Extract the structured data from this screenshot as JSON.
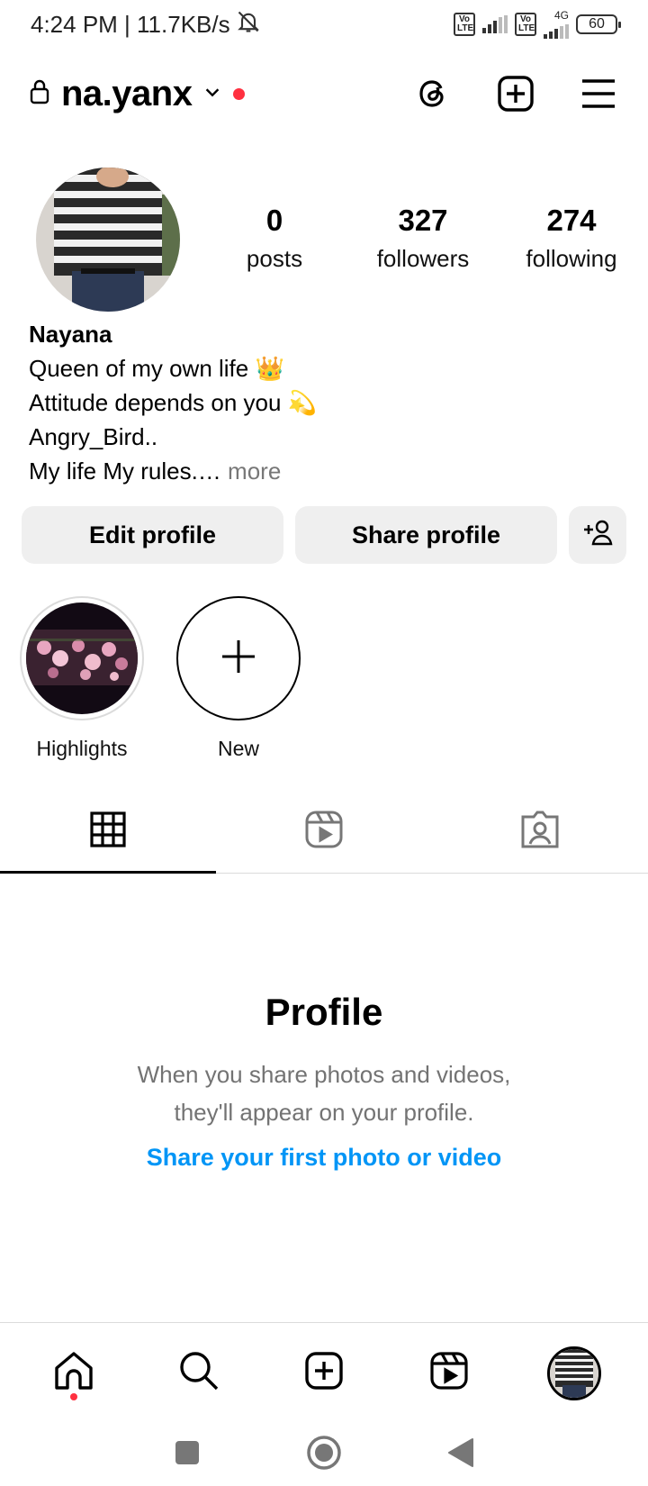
{
  "status_bar": {
    "time_speed": "4:24 PM | 11.7KB/s",
    "volte1": "Vo LTE",
    "volte2": "Vo LTE",
    "network": "4G",
    "battery": "60"
  },
  "header": {
    "username": "na.yanx"
  },
  "stats": [
    {
      "count": "0",
      "label": "posts"
    },
    {
      "count": "327",
      "label": "followers"
    },
    {
      "count": "274",
      "label": "following"
    }
  ],
  "bio": {
    "name": "Nayana",
    "line1": "Queen of my own life 👑",
    "line2": "Attitude depends on you 💫",
    "line3": "Angry_Bird..",
    "line4": "My life My rules.…",
    "more": "more"
  },
  "buttons": {
    "edit": "Edit profile",
    "share": "Share profile"
  },
  "highlights": [
    {
      "label": "Highlights"
    },
    {
      "label": "New"
    }
  ],
  "empty_state": {
    "title": "Profile",
    "line1": "When you share photos and videos,",
    "line2": "they'll appear on your profile.",
    "link": "Share your first photo or video"
  },
  "colors": {
    "accent_link": "#0095f6",
    "notification_dot": "#ff3040",
    "button_bg": "#efefef"
  }
}
